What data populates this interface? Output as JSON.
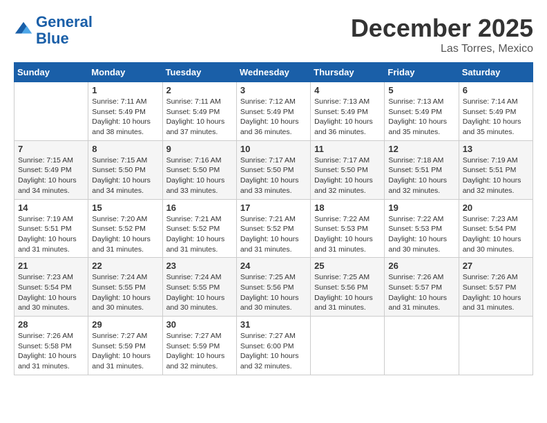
{
  "logo": {
    "line1": "General",
    "line2": "Blue"
  },
  "title": "December 2025",
  "location": "Las Torres, Mexico",
  "days_of_week": [
    "Sunday",
    "Monday",
    "Tuesday",
    "Wednesday",
    "Thursday",
    "Friday",
    "Saturday"
  ],
  "weeks": [
    [
      {
        "num": "",
        "sunrise": "",
        "sunset": "",
        "daylight": ""
      },
      {
        "num": "1",
        "sunrise": "Sunrise: 7:11 AM",
        "sunset": "Sunset: 5:49 PM",
        "daylight": "Daylight: 10 hours and 38 minutes."
      },
      {
        "num": "2",
        "sunrise": "Sunrise: 7:11 AM",
        "sunset": "Sunset: 5:49 PM",
        "daylight": "Daylight: 10 hours and 37 minutes."
      },
      {
        "num": "3",
        "sunrise": "Sunrise: 7:12 AM",
        "sunset": "Sunset: 5:49 PM",
        "daylight": "Daylight: 10 hours and 36 minutes."
      },
      {
        "num": "4",
        "sunrise": "Sunrise: 7:13 AM",
        "sunset": "Sunset: 5:49 PM",
        "daylight": "Daylight: 10 hours and 36 minutes."
      },
      {
        "num": "5",
        "sunrise": "Sunrise: 7:13 AM",
        "sunset": "Sunset: 5:49 PM",
        "daylight": "Daylight: 10 hours and 35 minutes."
      },
      {
        "num": "6",
        "sunrise": "Sunrise: 7:14 AM",
        "sunset": "Sunset: 5:49 PM",
        "daylight": "Daylight: 10 hours and 35 minutes."
      }
    ],
    [
      {
        "num": "7",
        "sunrise": "Sunrise: 7:15 AM",
        "sunset": "Sunset: 5:49 PM",
        "daylight": "Daylight: 10 hours and 34 minutes."
      },
      {
        "num": "8",
        "sunrise": "Sunrise: 7:15 AM",
        "sunset": "Sunset: 5:50 PM",
        "daylight": "Daylight: 10 hours and 34 minutes."
      },
      {
        "num": "9",
        "sunrise": "Sunrise: 7:16 AM",
        "sunset": "Sunset: 5:50 PM",
        "daylight": "Daylight: 10 hours and 33 minutes."
      },
      {
        "num": "10",
        "sunrise": "Sunrise: 7:17 AM",
        "sunset": "Sunset: 5:50 PM",
        "daylight": "Daylight: 10 hours and 33 minutes."
      },
      {
        "num": "11",
        "sunrise": "Sunrise: 7:17 AM",
        "sunset": "Sunset: 5:50 PM",
        "daylight": "Daylight: 10 hours and 32 minutes."
      },
      {
        "num": "12",
        "sunrise": "Sunrise: 7:18 AM",
        "sunset": "Sunset: 5:51 PM",
        "daylight": "Daylight: 10 hours and 32 minutes."
      },
      {
        "num": "13",
        "sunrise": "Sunrise: 7:19 AM",
        "sunset": "Sunset: 5:51 PM",
        "daylight": "Daylight: 10 hours and 32 minutes."
      }
    ],
    [
      {
        "num": "14",
        "sunrise": "Sunrise: 7:19 AM",
        "sunset": "Sunset: 5:51 PM",
        "daylight": "Daylight: 10 hours and 31 minutes."
      },
      {
        "num": "15",
        "sunrise": "Sunrise: 7:20 AM",
        "sunset": "Sunset: 5:52 PM",
        "daylight": "Daylight: 10 hours and 31 minutes."
      },
      {
        "num": "16",
        "sunrise": "Sunrise: 7:21 AM",
        "sunset": "Sunset: 5:52 PM",
        "daylight": "Daylight: 10 hours and 31 minutes."
      },
      {
        "num": "17",
        "sunrise": "Sunrise: 7:21 AM",
        "sunset": "Sunset: 5:52 PM",
        "daylight": "Daylight: 10 hours and 31 minutes."
      },
      {
        "num": "18",
        "sunrise": "Sunrise: 7:22 AM",
        "sunset": "Sunset: 5:53 PM",
        "daylight": "Daylight: 10 hours and 31 minutes."
      },
      {
        "num": "19",
        "sunrise": "Sunrise: 7:22 AM",
        "sunset": "Sunset: 5:53 PM",
        "daylight": "Daylight: 10 hours and 30 minutes."
      },
      {
        "num": "20",
        "sunrise": "Sunrise: 7:23 AM",
        "sunset": "Sunset: 5:54 PM",
        "daylight": "Daylight: 10 hours and 30 minutes."
      }
    ],
    [
      {
        "num": "21",
        "sunrise": "Sunrise: 7:23 AM",
        "sunset": "Sunset: 5:54 PM",
        "daylight": "Daylight: 10 hours and 30 minutes."
      },
      {
        "num": "22",
        "sunrise": "Sunrise: 7:24 AM",
        "sunset": "Sunset: 5:55 PM",
        "daylight": "Daylight: 10 hours and 30 minutes."
      },
      {
        "num": "23",
        "sunrise": "Sunrise: 7:24 AM",
        "sunset": "Sunset: 5:55 PM",
        "daylight": "Daylight: 10 hours and 30 minutes."
      },
      {
        "num": "24",
        "sunrise": "Sunrise: 7:25 AM",
        "sunset": "Sunset: 5:56 PM",
        "daylight": "Daylight: 10 hours and 30 minutes."
      },
      {
        "num": "25",
        "sunrise": "Sunrise: 7:25 AM",
        "sunset": "Sunset: 5:56 PM",
        "daylight": "Daylight: 10 hours and 31 minutes."
      },
      {
        "num": "26",
        "sunrise": "Sunrise: 7:26 AM",
        "sunset": "Sunset: 5:57 PM",
        "daylight": "Daylight: 10 hours and 31 minutes."
      },
      {
        "num": "27",
        "sunrise": "Sunrise: 7:26 AM",
        "sunset": "Sunset: 5:57 PM",
        "daylight": "Daylight: 10 hours and 31 minutes."
      }
    ],
    [
      {
        "num": "28",
        "sunrise": "Sunrise: 7:26 AM",
        "sunset": "Sunset: 5:58 PM",
        "daylight": "Daylight: 10 hours and 31 minutes."
      },
      {
        "num": "29",
        "sunrise": "Sunrise: 7:27 AM",
        "sunset": "Sunset: 5:59 PM",
        "daylight": "Daylight: 10 hours and 31 minutes."
      },
      {
        "num": "30",
        "sunrise": "Sunrise: 7:27 AM",
        "sunset": "Sunset: 5:59 PM",
        "daylight": "Daylight: 10 hours and 32 minutes."
      },
      {
        "num": "31",
        "sunrise": "Sunrise: 7:27 AM",
        "sunset": "Sunset: 6:00 PM",
        "daylight": "Daylight: 10 hours and 32 minutes."
      },
      {
        "num": "",
        "sunrise": "",
        "sunset": "",
        "daylight": ""
      },
      {
        "num": "",
        "sunrise": "",
        "sunset": "",
        "daylight": ""
      },
      {
        "num": "",
        "sunrise": "",
        "sunset": "",
        "daylight": ""
      }
    ]
  ]
}
